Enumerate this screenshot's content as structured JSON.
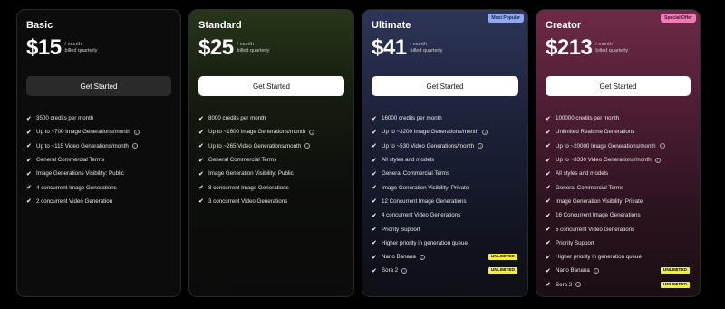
{
  "plans": [
    {
      "name": "Basic",
      "price": "$15",
      "period": "/ month",
      "billing": "billed quarterly",
      "cta": "Get Started",
      "badge": "",
      "features": [
        {
          "text": "3500 credits per month",
          "info": false,
          "tag": ""
        },
        {
          "text": "Up to ~700 Image Generations/month",
          "info": true,
          "tag": ""
        },
        {
          "text": "Up to ~115 Video Generations/month",
          "info": true,
          "tag": ""
        },
        {
          "text": "General Commercial Terms",
          "info": false,
          "tag": ""
        },
        {
          "text": "Image Generations Visibility: Public",
          "info": false,
          "tag": ""
        },
        {
          "text": "4 concurrent Image Generations",
          "info": false,
          "tag": ""
        },
        {
          "text": "2 concurrent Video Generation",
          "info": false,
          "tag": ""
        }
      ]
    },
    {
      "name": "Standard",
      "price": "$25",
      "period": "/ month",
      "billing": "billed quarterly",
      "cta": "Get Started",
      "badge": "",
      "features": [
        {
          "text": "8000 credits per month",
          "info": false,
          "tag": ""
        },
        {
          "text": "Up to ~1600 Image Generations/month",
          "info": true,
          "tag": ""
        },
        {
          "text": "Up to ~265 Video Generations/month",
          "info": true,
          "tag": ""
        },
        {
          "text": "General Commercial Terms",
          "info": false,
          "tag": ""
        },
        {
          "text": "Image Generation Visibility: Public",
          "info": false,
          "tag": ""
        },
        {
          "text": "8 concurrent Image Generations",
          "info": false,
          "tag": ""
        },
        {
          "text": "3 concurrent Video Generations",
          "info": false,
          "tag": ""
        }
      ]
    },
    {
      "name": "Ultimate",
      "price": "$41",
      "period": "/ month",
      "billing": "billed quarterly",
      "cta": "Get Started",
      "badge": "Most Popular",
      "features": [
        {
          "text": "16000 credits per month",
          "info": false,
          "tag": ""
        },
        {
          "text": "Up to ~3200 Image Generations/month",
          "info": true,
          "tag": ""
        },
        {
          "text": "Up to ~530 Video Generations/month",
          "info": true,
          "tag": ""
        },
        {
          "text": "All styles and models",
          "info": false,
          "tag": ""
        },
        {
          "text": "General Commercial Terms",
          "info": false,
          "tag": ""
        },
        {
          "text": "Image Generation Visibility: Private",
          "info": false,
          "tag": ""
        },
        {
          "text": "12 Concurrent Image Generations",
          "info": false,
          "tag": ""
        },
        {
          "text": "4 concurrent Video Generations",
          "info": false,
          "tag": ""
        },
        {
          "text": "Priority Support",
          "info": false,
          "tag": ""
        },
        {
          "text": "Higher priority in generation queue",
          "info": false,
          "tag": ""
        },
        {
          "text": "Nano Banana",
          "info": true,
          "tag": "UNLIMITED"
        },
        {
          "text": "Sora 2",
          "info": true,
          "tag": "UNLIMITED"
        }
      ]
    },
    {
      "name": "Creator",
      "price": "$213",
      "period": "/ month",
      "billing": "billed quarterly",
      "cta": "Get Started",
      "badge": "Special Offer",
      "features": [
        {
          "text": "100000 credits per month",
          "info": false,
          "tag": ""
        },
        {
          "text": "Unlimited Realtime Generations",
          "info": false,
          "tag": ""
        },
        {
          "text": "Up to ~20000 Image Generations/month",
          "info": true,
          "tag": ""
        },
        {
          "text": "Up to ~3330 Video Generations/month",
          "info": true,
          "tag": ""
        },
        {
          "text": "All styles and models",
          "info": false,
          "tag": ""
        },
        {
          "text": "General Commercial Terms",
          "info": false,
          "tag": ""
        },
        {
          "text": "Image Generation Visibility: Private",
          "info": false,
          "tag": ""
        },
        {
          "text": "16 Concurrent Image Generations",
          "info": false,
          "tag": ""
        },
        {
          "text": "5 concurrent Video Generations",
          "info": false,
          "tag": ""
        },
        {
          "text": "Priority Support",
          "info": false,
          "tag": ""
        },
        {
          "text": "Higher priority in generation queue",
          "info": false,
          "tag": ""
        },
        {
          "text": "Nano Banana",
          "info": true,
          "tag": "UNLIMITED"
        },
        {
          "text": "Sora 2",
          "info": true,
          "tag": "UNLIMITED"
        }
      ]
    }
  ],
  "icons": {
    "check": "check-icon",
    "info": "info-icon"
  }
}
